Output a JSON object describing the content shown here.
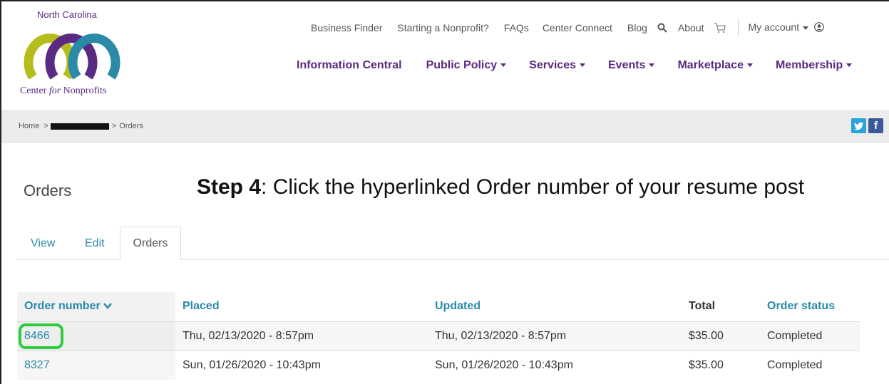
{
  "logo": {
    "top_text": "North Carolina",
    "bottom_pre": "Center ",
    "bottom_italic": "for",
    "bottom_post": " Nonprofits"
  },
  "util_nav": [
    "Business Finder",
    "Starting a Nonprofit?",
    "FAQs",
    "Center Connect",
    "Blog"
  ],
  "util_about": "About",
  "util_account": "My account",
  "main_nav": [
    {
      "label": "Information Central",
      "caret": false
    },
    {
      "label": "Public Policy",
      "caret": true
    },
    {
      "label": "Services",
      "caret": true
    },
    {
      "label": "Events",
      "caret": true
    },
    {
      "label": "Marketplace",
      "caret": true
    },
    {
      "label": "Membership",
      "caret": true
    }
  ],
  "breadcrumb": {
    "home": "Home",
    "sep": ">",
    "current": "Orders"
  },
  "page_title": "Orders",
  "instruction": {
    "bold": "Step 4",
    "text": ": Click the hyperlinked Order number of your resume post"
  },
  "tabs": [
    "View",
    "Edit",
    "Orders"
  ],
  "table": {
    "headers": [
      "Order number",
      "Placed",
      "Updated",
      "Total",
      "Order status"
    ],
    "rows": [
      {
        "order": "8466",
        "placed": "Thu, 02/13/2020 - 8:57pm",
        "updated": "Thu, 02/13/2020 - 8:57pm",
        "total": "$35.00",
        "status": "Completed"
      },
      {
        "order": "8327",
        "placed": "Sun, 01/26/2020 - 10:43pm",
        "updated": "Sun, 01/26/2020 - 10:43pm",
        "total": "$35.00",
        "status": "Completed"
      }
    ]
  },
  "colors": {
    "purple": "#5a2a82",
    "teal": "#2a8aa8",
    "lime": "#b5bd1c",
    "highlight": "#2ecc40"
  },
  "social": {
    "twitter": "t",
    "facebook": "f"
  }
}
